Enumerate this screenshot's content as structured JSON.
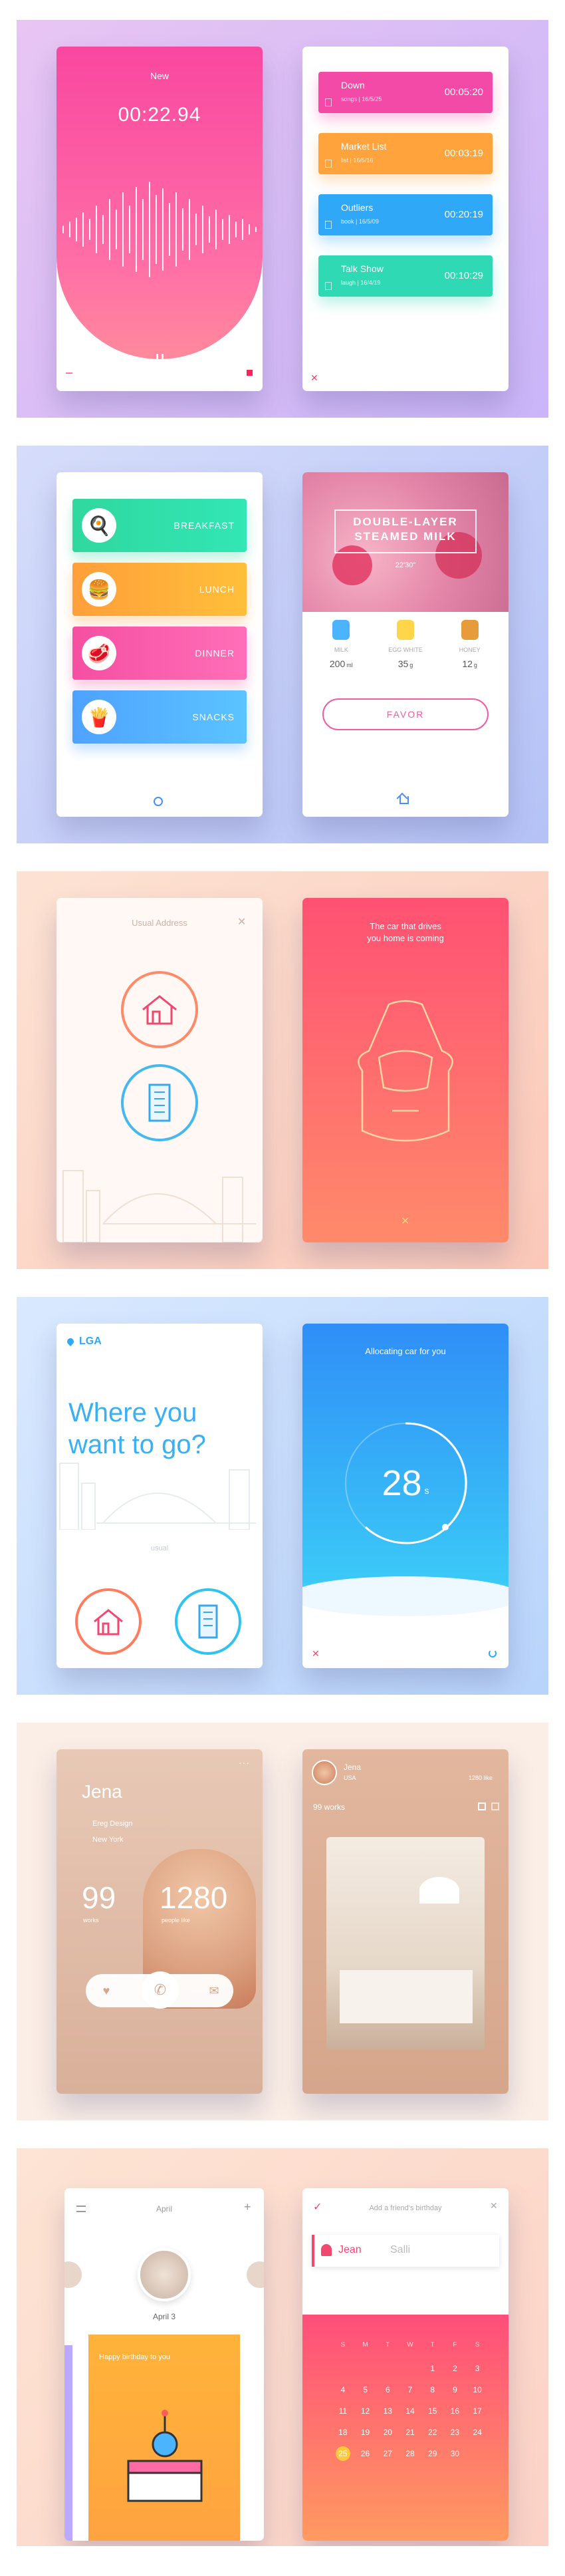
{
  "recorder": {
    "title": "New",
    "time": "00:22.94",
    "items": [
      {
        "name": "Down",
        "meta": "songs | 16/5/25",
        "dur": "00:05:20",
        "color": "#f24aa6"
      },
      {
        "name": "Market List",
        "meta": "list | 16/5/16",
        "dur": "00:03:19",
        "color": "#ffa33d"
      },
      {
        "name": "Outliers",
        "meta": "book | 16/5/09",
        "dur": "00:20:19",
        "color": "#2ea8f7"
      },
      {
        "name": "Talk Show",
        "meta": "laugh | 16/4/19",
        "dur": "00:10:29",
        "color": "#2ed9b4"
      }
    ]
  },
  "food": {
    "meals": [
      {
        "label": "BREAKFAST",
        "c1": "#2fd89e",
        "c2": "#32e6b5"
      },
      {
        "label": "LUNCH",
        "c1": "#ff9f3a",
        "c2": "#ffbf3a"
      },
      {
        "label": "DINNER",
        "c1": "#f54fa1",
        "c2": "#ff6fb8"
      },
      {
        "label": "SNACKS",
        "c1": "#4ea2ff",
        "c2": "#5bc4ff"
      }
    ],
    "recipe": {
      "title1": "DOUBLE-LAYER",
      "title2": "STEAMED MILK",
      "duration": "22'30\"",
      "ingredients": [
        {
          "name": "MILK",
          "qty": "200",
          "unit": "ml"
        },
        {
          "name": "EGG WHITE",
          "qty": "35",
          "unit": "g"
        },
        {
          "name": "HONEY",
          "qty": "12",
          "unit": "g"
        }
      ],
      "button": "FAVOR"
    }
  },
  "car": {
    "address_title": "Usual Address",
    "headline1": "The car that drives",
    "headline2": "you home is coming"
  },
  "trip": {
    "location": "LGA",
    "question1": "Where you",
    "question2": "want to go?",
    "label": "usual",
    "allocating": "Allocating car for you",
    "seconds": "28",
    "unit": "s"
  },
  "profile": {
    "name": "Jena",
    "company": "Ereg Design",
    "city": "New York",
    "works": "99",
    "works_label": "works",
    "likes": "1280",
    "likes_label": "people like",
    "small_name": "Jena",
    "small_loc": "USA",
    "small_likes": "1280 like",
    "small_works": "99 works"
  },
  "calendar": {
    "month": "April",
    "date_label": "April 3",
    "greeting": "Happy birthday to you",
    "add_title": "Add a friend's birthday",
    "first": "Jean",
    "last": "Salli",
    "weekdays": [
      "S",
      "M",
      "T",
      "W",
      "T",
      "F",
      "S"
    ],
    "days": [
      "",
      "",
      "",
      "",
      "1",
      "2",
      "3",
      "4",
      "5",
      "6",
      "7",
      "8",
      "9",
      "10",
      "11",
      "12",
      "13",
      "14",
      "15",
      "16",
      "17",
      "18",
      "19",
      "20",
      "21",
      "22",
      "23",
      "24",
      "25",
      "26",
      "27",
      "28",
      "29",
      "30"
    ],
    "selected": "25"
  }
}
